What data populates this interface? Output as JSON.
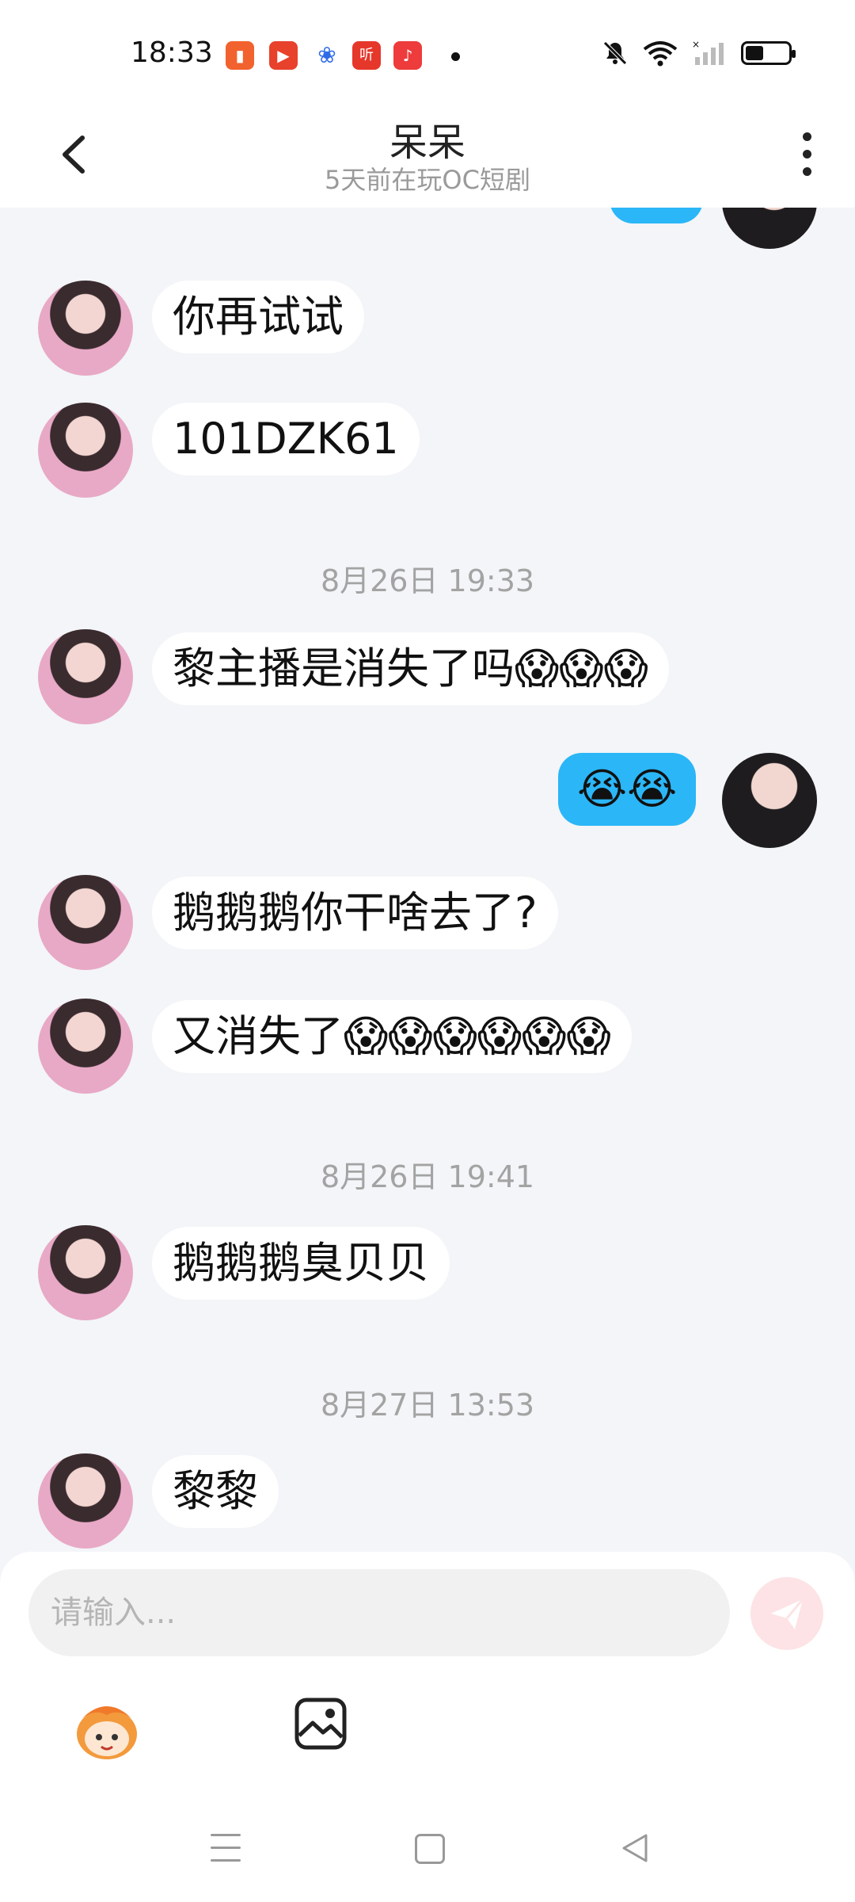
{
  "status_bar": {
    "time": "18:33",
    "app_icons": [
      {
        "name": "reader-app-icon",
        "color": "#f2622e",
        "glyph": "▮"
      },
      {
        "name": "video-app-icon",
        "color": "#e8412c",
        "glyph": "▶"
      },
      {
        "name": "baidu-app-icon",
        "color": "#2f6be8",
        "glyph": "❀"
      },
      {
        "name": "ting-app-icon",
        "color": "#e6372b",
        "glyph": "听"
      },
      {
        "name": "music-app-icon",
        "color": "#ee3b3b",
        "glyph": "♪"
      }
    ]
  },
  "header": {
    "title": "呆呆",
    "subtitle": "5天前在玩OC短剧"
  },
  "messages": [
    {
      "id": "m1",
      "side": "left",
      "text": "你再试试"
    },
    {
      "id": "m2",
      "side": "left",
      "text": "101DZK61"
    },
    {
      "id": "t1",
      "type": "timestamp",
      "text": "8月26日 19:33"
    },
    {
      "id": "m3",
      "side": "left",
      "text": "黎主播是消失了吗😱😱😱"
    },
    {
      "id": "m4",
      "side": "right",
      "text": "😭😭"
    },
    {
      "id": "m5",
      "side": "left",
      "text": "鹅鹅鹅你干啥去了?"
    },
    {
      "id": "m6",
      "side": "left",
      "text": "又消失了😱😱😱😱😱😱"
    },
    {
      "id": "t2",
      "type": "timestamp",
      "text": "8月26日 19:41"
    },
    {
      "id": "m7",
      "side": "left",
      "text": "鹅鹅鹅臭贝贝"
    },
    {
      "id": "t3",
      "type": "timestamp",
      "text": "8月27日 13:53"
    },
    {
      "id": "m8",
      "side": "left",
      "text": "黎黎"
    }
  ],
  "input": {
    "placeholder": "请输入..."
  },
  "colors": {
    "chat_background": "#f3f5f8",
    "my_bubble": "#2bb6f7",
    "send_button": "#fde3e5"
  }
}
